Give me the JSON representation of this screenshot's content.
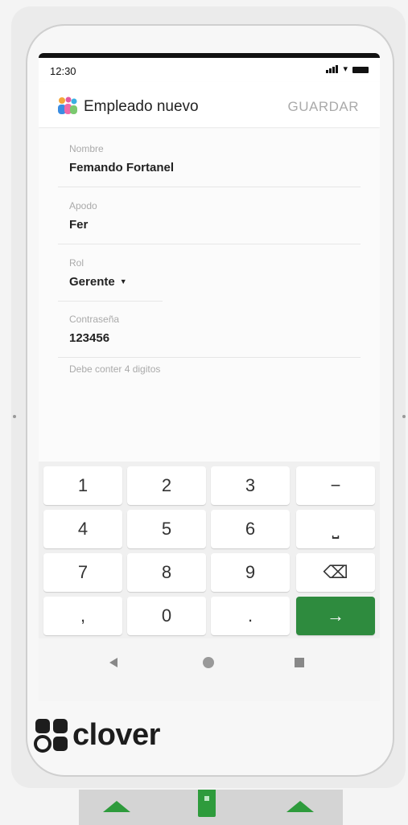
{
  "status": {
    "time": "12:30"
  },
  "app_bar": {
    "title": "Empleado nuevo",
    "save_label": "GUARDAR"
  },
  "form": {
    "name": {
      "label": "Nombre",
      "value": "Femando Fortanel"
    },
    "nickname": {
      "label": "Apodo",
      "value": "Fer"
    },
    "role": {
      "label": "Rol",
      "value": "Gerente"
    },
    "password": {
      "label": "Contraseña",
      "value": "123456"
    },
    "hint": "Debe conter 4 digitos"
  },
  "keypad": {
    "keys": [
      "1",
      "2",
      "3",
      "−",
      "4",
      "5",
      "6",
      "⎵",
      "7",
      "8",
      "9",
      "⌫",
      ",",
      "0",
      ".",
      "→"
    ]
  },
  "brand": {
    "name": "clover"
  },
  "colors": {
    "accent": "#2e8b3e",
    "dock_green": "#2e9b3c"
  }
}
